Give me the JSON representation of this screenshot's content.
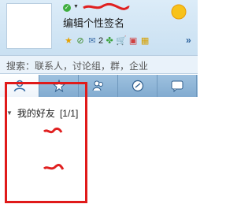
{
  "profile": {
    "signature": "编辑个性签名",
    "status_arrow": "▼"
  },
  "apps": {
    "mail_count": "2",
    "more": "»"
  },
  "search": {
    "placeholder": "搜索：联系人，讨论组，群，企业"
  },
  "tabs": [
    {
      "name": "contacts",
      "active": true
    },
    {
      "name": "favorites",
      "active": false
    },
    {
      "name": "groups",
      "active": false
    },
    {
      "name": "zone",
      "active": false
    },
    {
      "name": "recent",
      "active": false
    }
  ],
  "friends_group": {
    "label": "我的好友",
    "count": "[1/1]",
    "arrow": "▼"
  },
  "colors": {
    "highlight": "#e01a1a",
    "header_bg": "#d3e7f6",
    "tab_bg": "#8fb6d8"
  }
}
